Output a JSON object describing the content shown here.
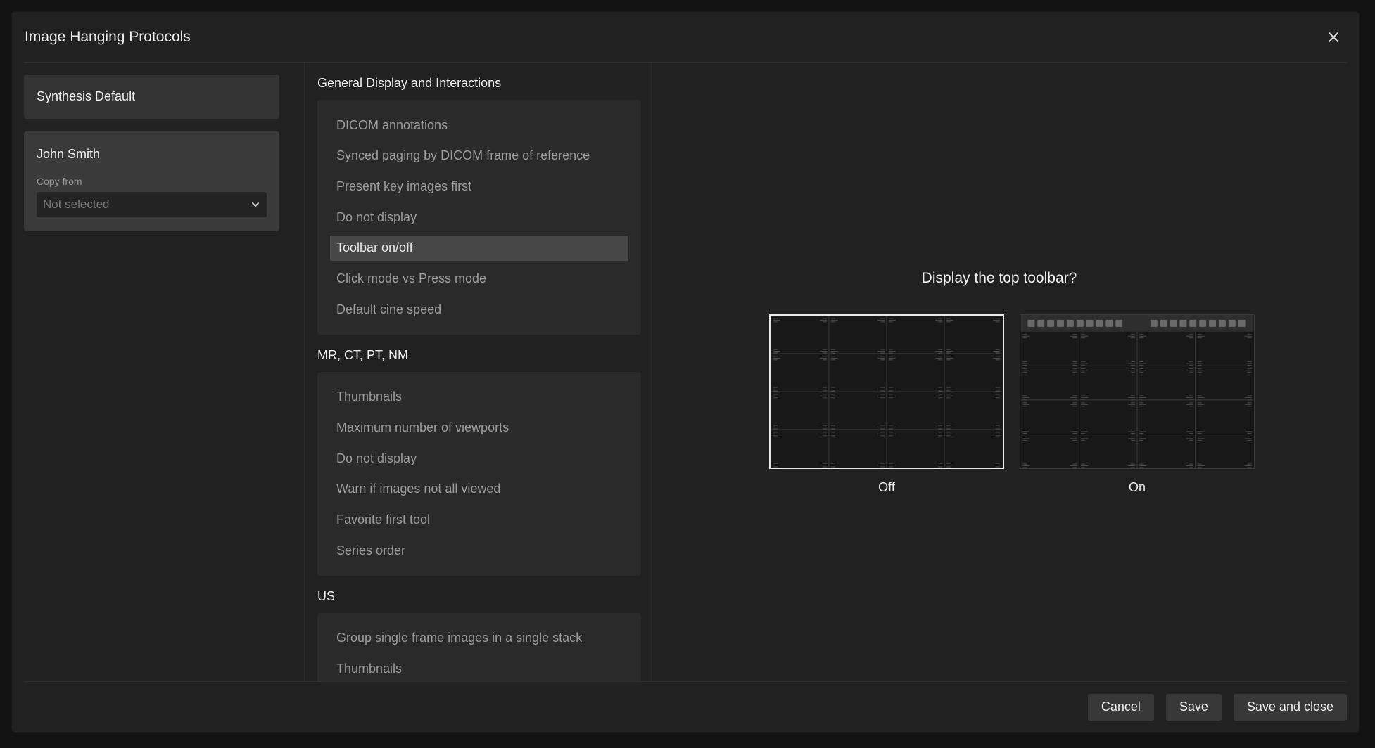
{
  "modal": {
    "title": "Image Hanging Protocols",
    "close_icon": "close-icon"
  },
  "profiles": {
    "default_name": "Synthesis Default",
    "user_name": "John Smith",
    "copy_label": "Copy from",
    "copy_value": "Not selected",
    "chevron_icon": "chevron-down-icon"
  },
  "sections": [
    {
      "title": "General Display and Interactions",
      "items": [
        "DICOM annotations",
        "Synced paging by DICOM frame of reference",
        "Present key images first",
        "Do not display",
        "Toolbar on/off",
        "Click mode vs Press mode",
        "Default cine speed"
      ],
      "active_index": 4
    },
    {
      "title": "MR, CT, PT, NM",
      "items": [
        "Thumbnails",
        "Maximum number of viewports",
        "Do not display",
        "Warn if images not all viewed",
        "Favorite first tool",
        "Series order"
      ]
    },
    {
      "title": "US",
      "items": [
        "Group single frame images in a single stack",
        "Thumbnails"
      ]
    }
  ],
  "preview": {
    "question": "Display the top toolbar?",
    "options": [
      {
        "label": "Off",
        "selected": true
      },
      {
        "label": "On",
        "selected": false
      }
    ]
  },
  "footer": {
    "cancel_label": "Cancel",
    "save_label": "Save",
    "save_close_label": "Save and close"
  },
  "colors": {
    "background": "#121212",
    "modal": "#212121",
    "active_item": "#474747",
    "selected_border": "#e8e8e8"
  }
}
